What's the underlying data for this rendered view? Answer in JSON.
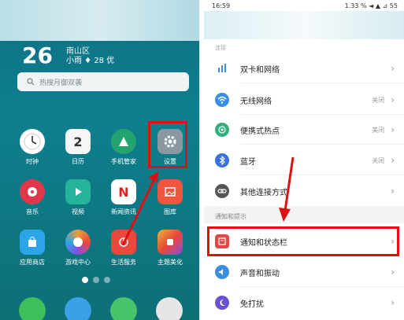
{
  "home": {
    "clock": "26",
    "weather_line1": "南山区",
    "weather_line2": "小雨 ♦ 28 优",
    "search_placeholder": "热搜月御双袭",
    "apps": [
      {
        "label": "时钟",
        "color": "#ffffff"
      },
      {
        "label": "日历",
        "color": "#f6f6f6",
        "icon_text": "2"
      },
      {
        "label": "手机管家",
        "color": "#23a46e"
      },
      {
        "label": "设置",
        "color": "#8b98a1"
      },
      {
        "label": "音乐",
        "color": "#e0384a"
      },
      {
        "label": "视频",
        "color": "#25b39a"
      },
      {
        "label": "新闻资讯",
        "color": "#ffffff",
        "icon_text": "N"
      },
      {
        "label": "图库",
        "color": "#f0553e"
      },
      {
        "label": "应用商店",
        "color": "#2aa6e8"
      },
      {
        "label": "游戏中心",
        "color": "#f09a3a"
      },
      {
        "label": "生活服务",
        "color": "#e9483a"
      },
      {
        "label": "主题美化",
        "color": "#e6b53a"
      }
    ],
    "dock": [
      {
        "name": "phone",
        "color": "#3fbf5a"
      },
      {
        "name": "browser",
        "color": "#3aa0e8"
      },
      {
        "name": "messages",
        "color": "#48c36a"
      },
      {
        "name": "camera",
        "color": "#e6e6e6"
      }
    ],
    "page_indicator": {
      "current": 1,
      "total": 3
    }
  },
  "settings": {
    "status_time": "16:59",
    "status_right": "1.33 % ◄ ▲ ⊿ 55",
    "small_header": "连接",
    "rows": [
      {
        "label": "双卡和网络",
        "status": "",
        "icon": "dual-sim-icon",
        "color": "#3a8fe0"
      },
      {
        "label": "无线网络",
        "status": "关闭",
        "icon": "wifi-icon",
        "color": "#3a8fe0"
      },
      {
        "label": "便携式热点",
        "status": "美闭",
        "icon": "hotspot-icon",
        "color": "#2fb07a"
      },
      {
        "label": "蓝牙",
        "status": "关闭",
        "icon": "bluetooth-icon",
        "color": "#3a70e0"
      },
      {
        "label": "其他连接方式",
        "status": "",
        "icon": "link-icon",
        "color": "#555555"
      }
    ],
    "group_label": "通知和提示",
    "rows2": [
      {
        "label": "通知和状态栏",
        "status": "",
        "icon": "notification-icon",
        "color": "#e04848"
      },
      {
        "label": "声音和振动",
        "status": "",
        "icon": "sound-icon",
        "color": "#3a8fe0"
      },
      {
        "label": "免打扰",
        "status": "",
        "icon": "moon-icon",
        "color": "#6a4fd0"
      }
    ]
  },
  "accent": "#d11111"
}
